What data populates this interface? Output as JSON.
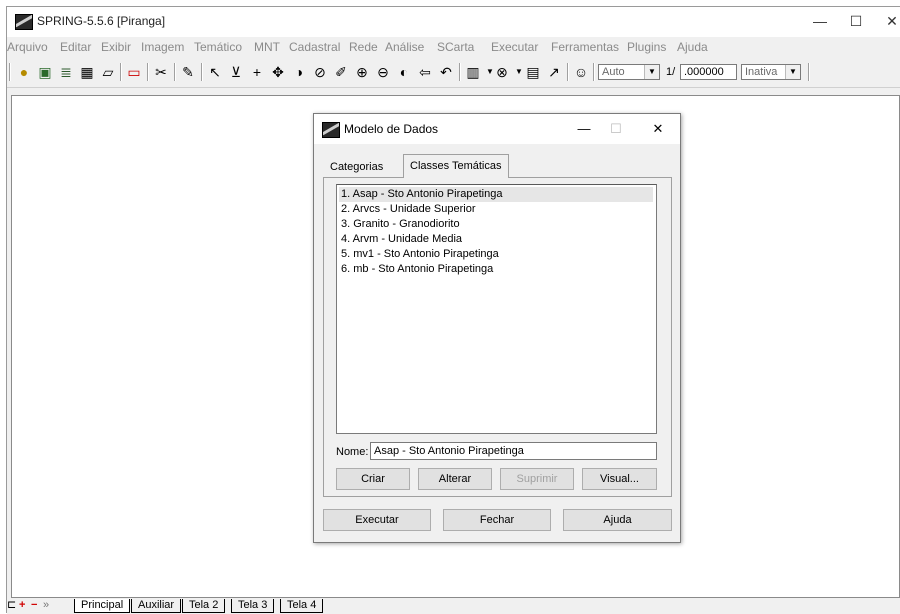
{
  "app": {
    "title": "SPRING-5.5.6 [Piranga]"
  },
  "window_controls": {
    "minimize": "—",
    "maximize": "☐",
    "close": "✕"
  },
  "menu": [
    "Arquivo",
    "Editar",
    "Exibir",
    "Imagem",
    "Temático",
    "MNT",
    "Cadastral",
    "Rede",
    "Análise",
    "SCarta",
    "Executar",
    "Ferramentas",
    "Plugins",
    "Ajuda"
  ],
  "toolbar": {
    "mode_value": "Auto",
    "scale_prefix": "1/",
    "scale_value": ".000000",
    "state_value": "Inativa"
  },
  "bottom_tabs": [
    "Principal",
    "Auxiliar",
    "Tela 2",
    "Tela 3",
    "Tela 4"
  ],
  "bottom_icons": {
    "add": "+",
    "remove": "−",
    "arrow": "»"
  },
  "dialog": {
    "title": "Modelo de Dados",
    "controls": {
      "minimize": "—",
      "maximize": "☐",
      "close": "✕"
    },
    "tabs": [
      {
        "label": "Categorias",
        "active": false
      },
      {
        "label": "Classes Temáticas",
        "active": true
      }
    ],
    "list": [
      "1. Asap - Sto Antonio Pirapetinga",
      "2. Arvcs - Unidade Superior",
      "3. Granito - Granodiorito",
      "4. Arvm - Unidade Media",
      "5. mv1 - Sto Antonio Pirapetinga",
      "6. mb - Sto Antonio Pirapetinga"
    ],
    "selected_index": 0,
    "nome_label": "Nome:",
    "nome_value": "Asap - Sto Antonio Pirapetinga",
    "buttons": {
      "criar": "Criar",
      "alterar": "Alterar",
      "suprimir": "Suprimir",
      "visual": "Visual...",
      "executar": "Executar",
      "fechar": "Fechar",
      "ajuda": "Ajuda"
    }
  }
}
